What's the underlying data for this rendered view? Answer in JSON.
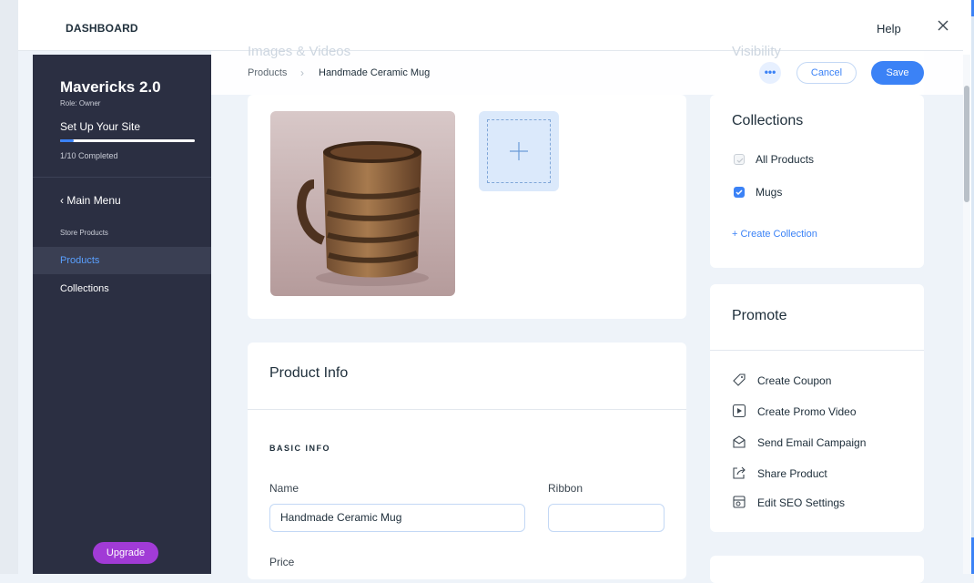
{
  "topbar": {
    "title": "DASHBOARD",
    "help": "Help"
  },
  "sidebar": {
    "site_name": "Mavericks 2.0",
    "role": "Role: Owner",
    "setup_label": "Set Up Your Site",
    "setup_progress": 0.1,
    "setup_status": "1/10 Completed",
    "main_menu": "Main Menu",
    "section": "Store Products",
    "items": [
      {
        "label": "Products",
        "active": true
      },
      {
        "label": "Collections",
        "active": false
      }
    ],
    "upgrade": "Upgrade",
    "colors": {
      "background": "#2b2f42",
      "active_text": "#5aa0ff",
      "upgrade": "#a13bd6"
    }
  },
  "actionbar": {
    "breadcrumb": [
      "Products",
      "Handmade Ceramic Mug"
    ],
    "more": "•••",
    "cancel": "Cancel",
    "save": "Save",
    "ghost_left": "Images & Videos",
    "ghost_right": "Visibility"
  },
  "images": {
    "add_icon": "plus-icon"
  },
  "product_info": {
    "title": "Product Info",
    "section": "BASIC INFO",
    "name_label": "Name",
    "name_value": "Handmade Ceramic Mug",
    "ribbon_label": "Ribbon",
    "ribbon_value": "",
    "price_label": "Price"
  },
  "collections": {
    "title": "Collections",
    "items": [
      {
        "label": "All Products",
        "checked": true,
        "disabled": true
      },
      {
        "label": "Mugs",
        "checked": true,
        "disabled": false
      }
    ],
    "create": "+ Create Collection"
  },
  "promote": {
    "title": "Promote",
    "items": [
      {
        "label": "Create Coupon",
        "icon": "tag-icon"
      },
      {
        "label": "Create Promo Video",
        "icon": "play-icon"
      },
      {
        "label": "Send Email Campaign",
        "icon": "email-icon"
      },
      {
        "label": "Share Product",
        "icon": "share-icon"
      },
      {
        "label": "Edit SEO Settings",
        "icon": "seo-icon"
      }
    ]
  },
  "accent": "#3b82f6"
}
